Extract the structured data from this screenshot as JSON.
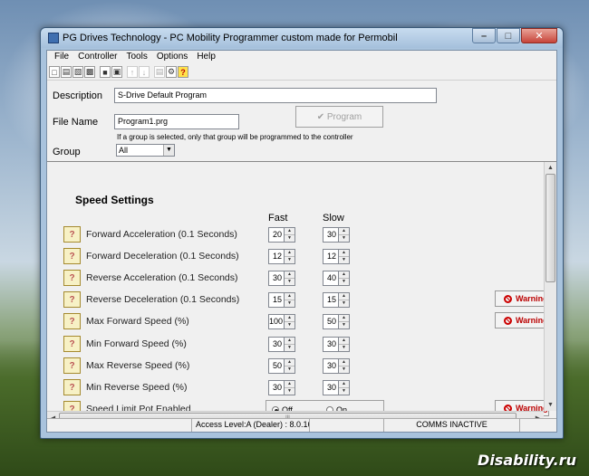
{
  "window": {
    "title": "PG Drives Technology - PC Mobility Programmer custom made for Permobil",
    "minimize": "–",
    "maximize": "□",
    "close": "✕"
  },
  "menu": [
    "File",
    "Controller",
    "Tools",
    "Options",
    "Help"
  ],
  "toolbar_icons": [
    "new-file-icon",
    "open-file-icon",
    "open-folder-icon",
    "print-icon",
    "save-icon",
    "save-all-icon",
    "upload-icon",
    "download-icon",
    "document-icon",
    "settings-icon",
    "help-icon"
  ],
  "form": {
    "description_label": "Description",
    "description_value": "S-Drive Default Program",
    "filename_label": "File Name",
    "filename_value": "Program1.prg",
    "program_button": "✔ Program",
    "group_note": "If a group is selected, only that group will be programmed to the controller",
    "group_label": "Group",
    "group_value": "All"
  },
  "speed": {
    "title": "Speed Settings",
    "col_fast": "Fast",
    "col_slow": "Slow",
    "help_label": "?",
    "warning_label": "Warning",
    "rows": [
      {
        "label": "Forward Acceleration (0.1 Seconds)",
        "fast": "20",
        "slow": "30"
      },
      {
        "label": "Forward Deceleration (0.1 Seconds)",
        "fast": "12",
        "slow": "12"
      },
      {
        "label": "Reverse Acceleration (0.1 Seconds)",
        "fast": "30",
        "slow": "40"
      },
      {
        "label": "Reverse Deceleration (0.1 Seconds)",
        "fast": "15",
        "slow": "15"
      },
      {
        "label": "Max Forward Speed (%)",
        "fast": "100",
        "slow": "50"
      },
      {
        "label": "Min Forward Speed (%)",
        "fast": "30",
        "slow": "30"
      },
      {
        "label": "Max Reverse Speed (%)",
        "fast": "50",
        "slow": "30"
      },
      {
        "label": "Min Reverse Speed (%)",
        "fast": "30",
        "slow": "30"
      }
    ],
    "pot_label": "Speed Limit Pot Enabled",
    "pot_off": "Off",
    "pot_on": "On"
  },
  "status": {
    "access": "Access Level:A (Dealer) : 8.0.16",
    "comms": "COMMS INACTIVE"
  },
  "watermark": "Disability.ru"
}
